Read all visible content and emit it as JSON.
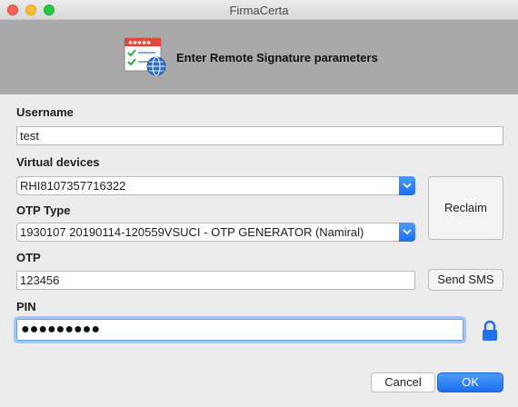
{
  "window": {
    "title": "FirmaCerta"
  },
  "header": {
    "title": "Enter Remote Signature parameters",
    "icon": "signature-certificate-icon"
  },
  "form": {
    "username": {
      "label": "Username",
      "value": "test"
    },
    "devices": {
      "label": "Virtual devices",
      "value": "RHI8107357716322"
    },
    "otp_type": {
      "label": "OTP Type",
      "value": "1930107 20190114-120559VSUCI - OTP GENERATOR (Namiral)"
    },
    "otp": {
      "label": "OTP",
      "value": "123456"
    },
    "pin": {
      "label": "PIN",
      "value": "●●●●●●●●●"
    }
  },
  "buttons": {
    "reclaim": "Reclaim",
    "send_sms": "Send SMS",
    "cancel": "Cancel",
    "ok": "OK"
  },
  "colors": {
    "accent": "#1f6ff0",
    "header_bg": "#a9a9a9",
    "lock": "#1f6ff0"
  }
}
